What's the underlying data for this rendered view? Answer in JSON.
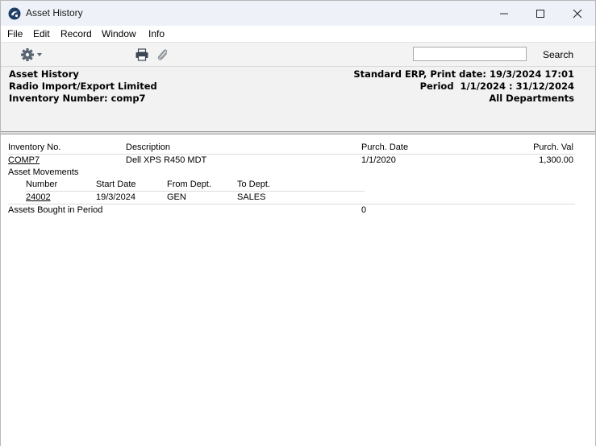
{
  "window": {
    "title": "Asset History",
    "controls": {
      "minimize": "minimize",
      "maximize": "maximize",
      "close": "close"
    }
  },
  "menu": {
    "items": [
      "File",
      "Edit",
      "Record",
      "Window",
      "Info"
    ]
  },
  "toolbar": {
    "icons": [
      "gear-icon",
      "print-icon",
      "paperclip-icon"
    ],
    "search": {
      "value": "",
      "placeholder": "",
      "button_label": "Search"
    }
  },
  "report_header": {
    "title": "Asset History",
    "company": "Radio Import/Export Limited",
    "inventory_filter": "Inventory Number: comp7",
    "system_print": "Standard ERP, Print date: 19/3/2024 17:01",
    "period": "Period  1/1/2024 : 31/12/2024",
    "departments": "All Departments"
  },
  "report": {
    "columns": {
      "inventory_no": "Inventory No.",
      "description": "Description",
      "purch_date": "Purch. Date",
      "purch_val": "Purch. Val"
    },
    "asset": {
      "inventory_no": "COMP7",
      "description": "Dell XPS R450 MDT",
      "purch_date": "1/1/2020",
      "purch_val": "1,300.00"
    },
    "movements": {
      "title": "Asset Movements",
      "columns": {
        "number": "Number",
        "start_date": "Start Date",
        "from_dept": "From Dept.",
        "to_dept": "To Dept."
      },
      "rows": [
        {
          "number": "24002",
          "start_date": "19/3/2024",
          "from_dept": "GEN",
          "to_dept": "SALES"
        }
      ]
    },
    "summary": {
      "label": "Assets Bought in Period",
      "value": "0"
    }
  },
  "colors": {
    "titlebar": "#eef2f8",
    "toolbar": "#f3f3f3",
    "report_header": "#f2f2f2",
    "icon_gray": "#5a6472"
  }
}
